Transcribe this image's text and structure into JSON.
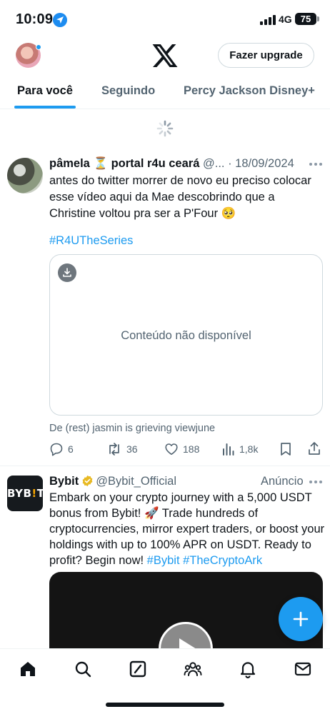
{
  "status_bar": {
    "time": "10:09",
    "network": "4G",
    "battery": "75",
    "icons": [
      "location-arrow-icon",
      "signal-bars-icon",
      "battery-icon"
    ]
  },
  "header": {
    "logo": "x-logo-icon",
    "upgrade_label": "Fazer upgrade"
  },
  "tabs": [
    {
      "label": "Para você",
      "active": true
    },
    {
      "label": "Seguindo",
      "active": false
    },
    {
      "label": "Percy Jackson Disney+",
      "active": false
    }
  ],
  "feed": {
    "tweet1": {
      "display_name": "pâmela ⏳ portal r4u ceará",
      "handle": "@...",
      "date": "· 18/09/2024",
      "text": "antes do twitter morrer de novo eu preciso colocar esse vídeo aqui da Mae descobrindo que a Christine voltou pra ser a P'Four 🥺",
      "hashtag": "#R4UTheSeries",
      "media_message": "Conteúdo não disponível",
      "from_line": "De (rest) jasmin is grieving viewjune",
      "replies": "6",
      "reposts": "36",
      "likes": "188",
      "views": "1,8k"
    },
    "tweet2": {
      "avatar_text_a": "BYB",
      "avatar_text_b": "!",
      "avatar_text_c": "T",
      "display_name": "Bybit",
      "handle": "@Bybit_Official",
      "ad_label": "Anúncio",
      "text": "Embark on your crypto journey with a 5,000 USDT bonus from Bybit! 🚀 Trade hundreds of cryptocurrencies, mirror expert traders, or boost your holdings with up to 100% APR on USDT. Ready to profit? Begin now! ",
      "hashtags": "#Bybit #TheCryptoArk"
    }
  },
  "colors": {
    "accent": "#1d9bf0",
    "text_primary": "#0f1419",
    "text_secondary": "#536471",
    "border": "#cfd9de"
  }
}
